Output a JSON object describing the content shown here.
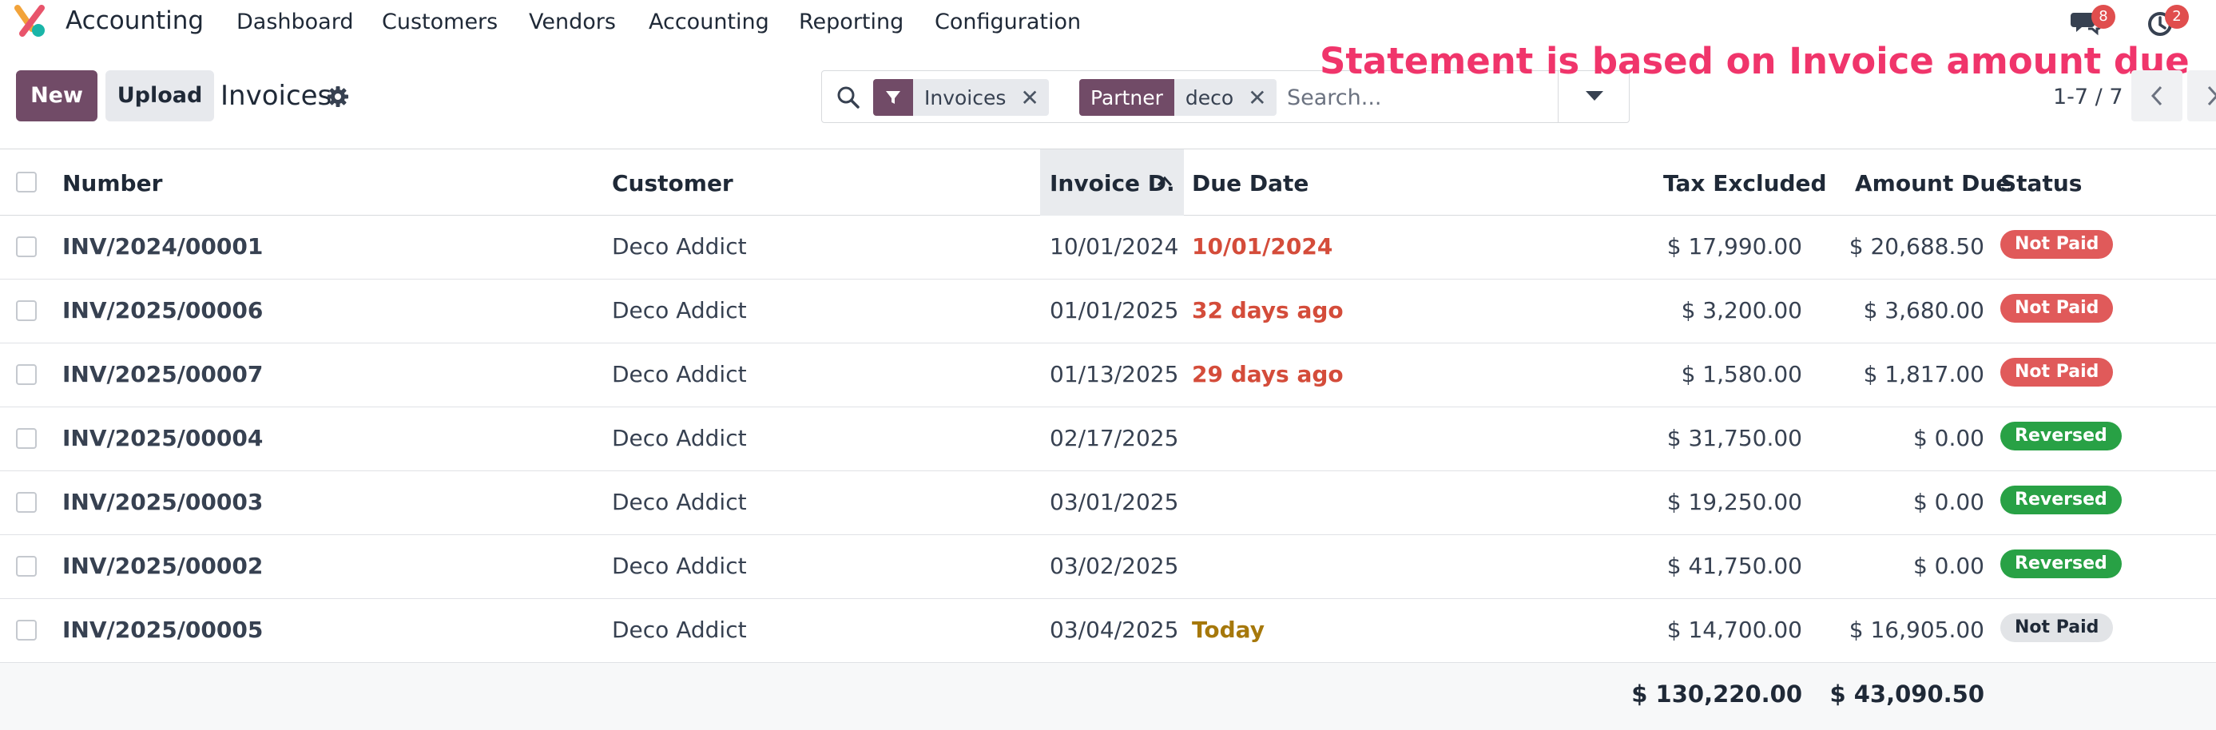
{
  "navbar": {
    "app_name": "Accounting",
    "menus": [
      "Dashboard",
      "Customers",
      "Vendors",
      "Accounting",
      "Reporting",
      "Configuration"
    ],
    "messages_count": "8",
    "activities_count": "2",
    "badge_color": "#e04e4e"
  },
  "control": {
    "new_label": "New",
    "upload_label": "Upload",
    "title": "Invoices",
    "brand_color": "#714b67"
  },
  "search": {
    "facet1_value": "Invoices",
    "facet2_tag": "Partner",
    "facet2_value": "deco",
    "placeholder": "Search..."
  },
  "annotation": "Statement is based on Invoice amount due",
  "pager": {
    "text": "1-7 / 7"
  },
  "table": {
    "columns": {
      "number": "Number",
      "customer": "Customer",
      "invoice_date": "Invoice D.",
      "due_date": "Due Date",
      "tax_excluded": "Tax Excluded",
      "amount_due": "Amount Due",
      "status": "Status"
    },
    "sorted_column": "invoice_date",
    "rows": [
      {
        "number": "INV/2024/00001",
        "customer": "Deco Addict",
        "invoice_date": "10/01/2024",
        "due_date": "10/01/2024",
        "due_style": "red",
        "tax_excluded": "$ 17,990.00",
        "amount_due": "$ 20,688.50",
        "status": "Not Paid",
        "status_style": "red"
      },
      {
        "number": "INV/2025/00006",
        "customer": "Deco Addict",
        "invoice_date": "01/01/2025",
        "due_date": "32 days ago",
        "due_style": "red",
        "tax_excluded": "$ 3,200.00",
        "amount_due": "$ 3,680.00",
        "status": "Not Paid",
        "status_style": "red"
      },
      {
        "number": "INV/2025/00007",
        "customer": "Deco Addict",
        "invoice_date": "01/13/2025",
        "due_date": "29 days ago",
        "due_style": "red",
        "tax_excluded": "$ 1,580.00",
        "amount_due": "$ 1,817.00",
        "status": "Not Paid",
        "status_style": "red"
      },
      {
        "number": "INV/2025/00004",
        "customer": "Deco Addict",
        "invoice_date": "02/17/2025",
        "due_date": "",
        "due_style": "none",
        "tax_excluded": "$ 31,750.00",
        "amount_due": "$ 0.00",
        "status": "Reversed",
        "status_style": "green"
      },
      {
        "number": "INV/2025/00003",
        "customer": "Deco Addict",
        "invoice_date": "03/01/2025",
        "due_date": "",
        "due_style": "none",
        "tax_excluded": "$ 19,250.00",
        "amount_due": "$ 0.00",
        "status": "Reversed",
        "status_style": "green"
      },
      {
        "number": "INV/2025/00002",
        "customer": "Deco Addict",
        "invoice_date": "03/02/2025",
        "due_date": "",
        "due_style": "none",
        "tax_excluded": "$ 41,750.00",
        "amount_due": "$ 0.00",
        "status": "Reversed",
        "status_style": "green"
      },
      {
        "number": "INV/2025/00005",
        "customer": "Deco Addict",
        "invoice_date": "03/04/2025",
        "due_date": "Today",
        "due_style": "amber",
        "tax_excluded": "$ 14,700.00",
        "amount_due": "$ 16,905.00",
        "status": "Not Paid",
        "status_style": "grey"
      }
    ],
    "totals": {
      "tax_excluded": "$ 130,220.00",
      "amount_due": "$ 43,090.50"
    }
  }
}
